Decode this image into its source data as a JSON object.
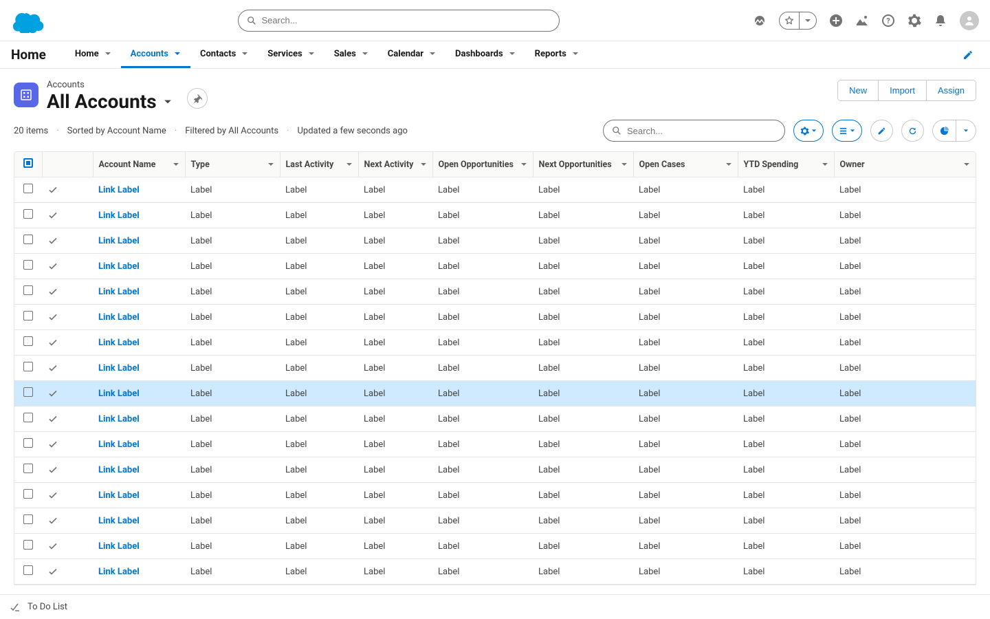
{
  "globalSearch": {
    "placeholder": "Search..."
  },
  "appName": "Home",
  "navTabs": [
    {
      "label": "Home",
      "active": false
    },
    {
      "label": "Accounts",
      "active": true
    },
    {
      "label": "Contacts",
      "active": false
    },
    {
      "label": "Services",
      "active": false
    },
    {
      "label": "Sales",
      "active": false
    },
    {
      "label": "Calendar",
      "active": false
    },
    {
      "label": "Dashboards",
      "active": false
    },
    {
      "label": "Reports",
      "active": false
    }
  ],
  "pageHeader": {
    "eyebrow": "Accounts",
    "title": "All Accounts",
    "actions": [
      "New",
      "Import",
      "Assign"
    ]
  },
  "meta": {
    "items": "20 items",
    "sorted": "Sorted by Account Name",
    "filtered": "Filtered by All Accounts",
    "updated": "Updated a few seconds ago"
  },
  "listSearch": {
    "placeholder": "Search..."
  },
  "columns": [
    "Account Name",
    "Type",
    "Last Activity",
    "Next Activity",
    "Open Opportunities",
    "Next Opportunities",
    "Open Cases",
    "YTD Spending",
    "Owner"
  ],
  "rows": [
    {
      "name": "Link Label",
      "type": "Label",
      "last": "Label",
      "next": "Label",
      "oppo": "Label",
      "noppo": "Label",
      "cases": "Label",
      "ytd": "Label",
      "owner": "Label",
      "hl": false
    },
    {
      "name": "Link Label",
      "type": "Label",
      "last": "Label",
      "next": "Label",
      "oppo": "Label",
      "noppo": "Label",
      "cases": "Label",
      "ytd": "Label",
      "owner": "Label",
      "hl": false
    },
    {
      "name": "Link Label",
      "type": "Label",
      "last": "Label",
      "next": "Label",
      "oppo": "Label",
      "noppo": "Label",
      "cases": "Label",
      "ytd": "Label",
      "owner": "Label",
      "hl": false
    },
    {
      "name": "Link Label",
      "type": "Label",
      "last": "Label",
      "next": "Label",
      "oppo": "Label",
      "noppo": "Label",
      "cases": "Label",
      "ytd": "Label",
      "owner": "Label",
      "hl": false
    },
    {
      "name": "Link Label",
      "type": "Label",
      "last": "Label",
      "next": "Label",
      "oppo": "Label",
      "noppo": "Label",
      "cases": "Label",
      "ytd": "Label",
      "owner": "Label",
      "hl": false
    },
    {
      "name": "Link Label",
      "type": "Label",
      "last": "Label",
      "next": "Label",
      "oppo": "Label",
      "noppo": "Label",
      "cases": "Label",
      "ytd": "Label",
      "owner": "Label",
      "hl": false
    },
    {
      "name": "Link Label",
      "type": "Label",
      "last": "Label",
      "next": "Label",
      "oppo": "Label",
      "noppo": "Label",
      "cases": "Label",
      "ytd": "Label",
      "owner": "Label",
      "hl": false
    },
    {
      "name": "Link Label",
      "type": "Label",
      "last": "Label",
      "next": "Label",
      "oppo": "Label",
      "noppo": "Label",
      "cases": "Label",
      "ytd": "Label",
      "owner": "Label",
      "hl": false
    },
    {
      "name": "Link Label",
      "type": "Label",
      "last": "Label",
      "next": "Label",
      "oppo": "Label",
      "noppo": "Label",
      "cases": "Label",
      "ytd": "Label",
      "owner": "Label",
      "hl": true
    },
    {
      "name": "Link Label",
      "type": "Label",
      "last": "Label",
      "next": "Label",
      "oppo": "Label",
      "noppo": "Label",
      "cases": "Label",
      "ytd": "Label",
      "owner": "Label",
      "hl": false
    },
    {
      "name": "Link Label",
      "type": "Label",
      "last": "Label",
      "next": "Label",
      "oppo": "Label",
      "noppo": "Label",
      "cases": "Label",
      "ytd": "Label",
      "owner": "Label",
      "hl": false
    },
    {
      "name": "Link Label",
      "type": "Label",
      "last": "Label",
      "next": "Label",
      "oppo": "Label",
      "noppo": "Label",
      "cases": "Label",
      "ytd": "Label",
      "owner": "Label",
      "hl": false
    },
    {
      "name": "Link Label",
      "type": "Label",
      "last": "Label",
      "next": "Label",
      "oppo": "Label",
      "noppo": "Label",
      "cases": "Label",
      "ytd": "Label",
      "owner": "Label",
      "hl": false
    },
    {
      "name": "Link Label",
      "type": "Label",
      "last": "Label",
      "next": "Label",
      "oppo": "Label",
      "noppo": "Label",
      "cases": "Label",
      "ytd": "Label",
      "owner": "Label",
      "hl": false
    },
    {
      "name": "Link Label",
      "type": "Label",
      "last": "Label",
      "next": "Label",
      "oppo": "Label",
      "noppo": "Label",
      "cases": "Label",
      "ytd": "Label",
      "owner": "Label",
      "hl": false
    },
    {
      "name": "Link Label",
      "type": "Label",
      "last": "Label",
      "next": "Label",
      "oppo": "Label",
      "noppo": "Label",
      "cases": "Label",
      "ytd": "Label",
      "owner": "Label",
      "hl": false
    }
  ],
  "footer": {
    "todo": "To Do List"
  }
}
